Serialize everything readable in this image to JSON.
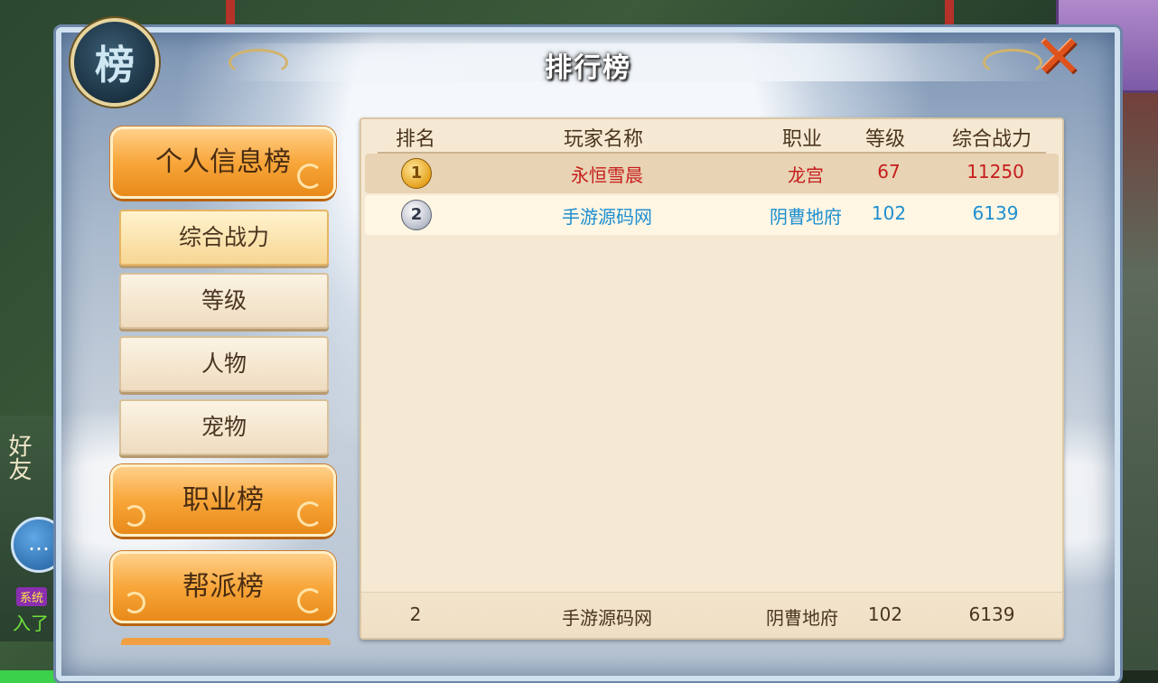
{
  "panel": {
    "title": "排行榜",
    "emblem": "榜",
    "close_glyph": "✕"
  },
  "left_menu": {
    "categories": [
      {
        "label": "个人信息榜"
      },
      {
        "label": "职业榜"
      },
      {
        "label": "帮派榜"
      }
    ],
    "sub_tabs": [
      {
        "label": "综合战力",
        "active": true
      },
      {
        "label": "等级",
        "active": false
      },
      {
        "label": "人物",
        "active": false
      },
      {
        "label": "宠物",
        "active": false
      }
    ]
  },
  "table": {
    "headers": [
      "排名",
      "玩家名称",
      "职业",
      "等级",
      "综合战力"
    ],
    "rows": [
      {
        "rank": "1",
        "medal": "gold-medal",
        "name": "永恒雪晨",
        "profession": "龙宫",
        "level": "67",
        "power": "11250",
        "color": "#c61d1d"
      },
      {
        "rank": "2",
        "medal": "silver-medal",
        "name": "手游源码网",
        "profession": "阴曹地府",
        "level": "102",
        "power": "6139",
        "color": "#1e8fd0"
      }
    ],
    "self_row": {
      "rank": "2",
      "name": "手游源码网",
      "profession": "阴曹地府",
      "level": "102",
      "power": "6139"
    }
  },
  "background": {
    "friend_text": "好友",
    "chat_icon": "chat-bubble-icon",
    "system_tag": "系统",
    "system_text": "入了"
  },
  "colors": {
    "accent": "#f8a63a",
    "rank1": "#c61d1d",
    "rank2": "#1e8fd0"
  }
}
